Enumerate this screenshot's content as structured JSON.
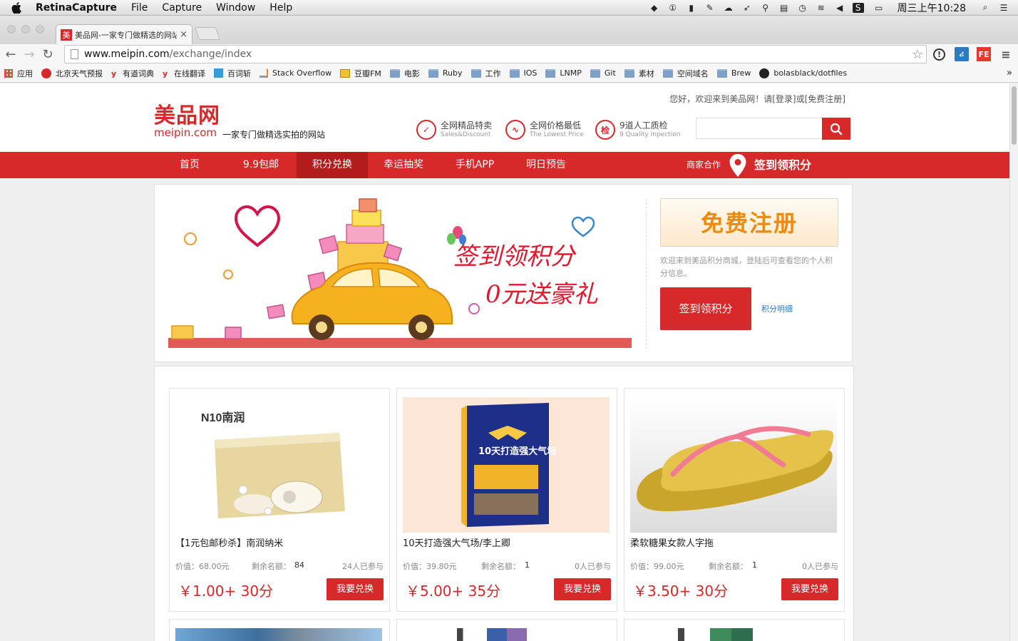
{
  "menubar": {
    "app": "RetinaCapture",
    "items": [
      "File",
      "Capture",
      "Window",
      "Help"
    ],
    "clock": "周三上午10:28"
  },
  "browser": {
    "tab_title": "美品网-一家专门做精选的网站",
    "favicon_char": "美",
    "url_host": "www.meipin.com",
    "url_path": "/exchange/index"
  },
  "bookmarks": [
    {
      "label": "应用",
      "icon": "apps-grid-icon"
    },
    {
      "label": "北京天气预报",
      "icon": "weather-icon"
    },
    {
      "label": "有道词典",
      "icon": "youdao-icon"
    },
    {
      "label": "在线翻译",
      "icon": "youdao-icon"
    },
    {
      "label": "百词斩",
      "icon": "page-icon"
    },
    {
      "label": "Stack Overflow",
      "icon": "stackoverflow-icon"
    },
    {
      "label": "豆瓣FM",
      "icon": "douban-icon"
    },
    {
      "label": "电影",
      "icon": "folder-icon"
    },
    {
      "label": "Ruby",
      "icon": "folder-icon"
    },
    {
      "label": "工作",
      "icon": "folder-icon"
    },
    {
      "label": "IOS",
      "icon": "folder-icon"
    },
    {
      "label": "LNMP",
      "icon": "folder-icon"
    },
    {
      "label": "Git",
      "icon": "folder-icon"
    },
    {
      "label": "素材",
      "icon": "folder-icon"
    },
    {
      "label": "空间域名",
      "icon": "folder-icon"
    },
    {
      "label": "Brew",
      "icon": "folder-icon"
    },
    {
      "label": "bolasblack/dotfiles",
      "icon": "github-icon"
    }
  ],
  "header": {
    "greeting": "您好，欢迎来到美品网！请",
    "login": "[登录]",
    "or": "或",
    "register": "[免费注册]",
    "logo_cn": "美品网",
    "logo_en": "meipin.com",
    "slogan": "一家专门做精选实拍的网站",
    "features": [
      {
        "icon": "tag-icon",
        "glyph": "✓",
        "title": "全网精品特卖",
        "sub": "Sales&Discount"
      },
      {
        "icon": "trend-icon",
        "glyph": "∿",
        "title": "全网价格最低",
        "sub": "The Lowest Price"
      },
      {
        "icon": "check-icon",
        "glyph": "检",
        "title": "9道人工质检",
        "sub": "9 Quality Inpection"
      }
    ],
    "search_placeholder": ""
  },
  "nav": {
    "items": [
      "首页",
      "9.9包邮",
      "积分兑换",
      "幸运抽奖",
      "手机APP",
      "明日预告"
    ],
    "active": "积分兑换",
    "partner": "商家合作",
    "signin": "签到领积分"
  },
  "banner": {
    "line1": "签到领积分",
    "line2": "0元送豪礼",
    "register_button": "免费注册",
    "welcome": "欢迎来到美品积分商城，登陆后可查看您的个人积分信息。",
    "signin_button": "签到领积分",
    "detail_link": "积分明细"
  },
  "products": [
    {
      "name": "【1元包邮秒杀】南润纳米",
      "value": "价值：68.00元",
      "remaining_label": "剩余名额：",
      "remaining": "84",
      "participants": "24人已参与",
      "price": "￥1.00+ 30分",
      "button": "我要兑换",
      "brand": "N10南润"
    },
    {
      "name": "10天打造强大气场/李上卿",
      "value": "价值：39.80元",
      "remaining_label": "剩余名额：",
      "remaining": "1",
      "participants": "0人已参与",
      "price": "￥5.00+ 35分",
      "button": "我要兑换",
      "book_title": "10天打造强大气场"
    },
    {
      "name": "柔软糖果女款人字拖",
      "value": "价值：99.00元",
      "remaining_label": "剩余名额：",
      "remaining": "1",
      "participants": "0人已参与",
      "price": "￥3.50+ 30分",
      "button": "我要兑换"
    }
  ],
  "colors": {
    "brand_red": "#d7282a",
    "orange": "#f08a0c",
    "link_blue": "#2a7bc6"
  }
}
